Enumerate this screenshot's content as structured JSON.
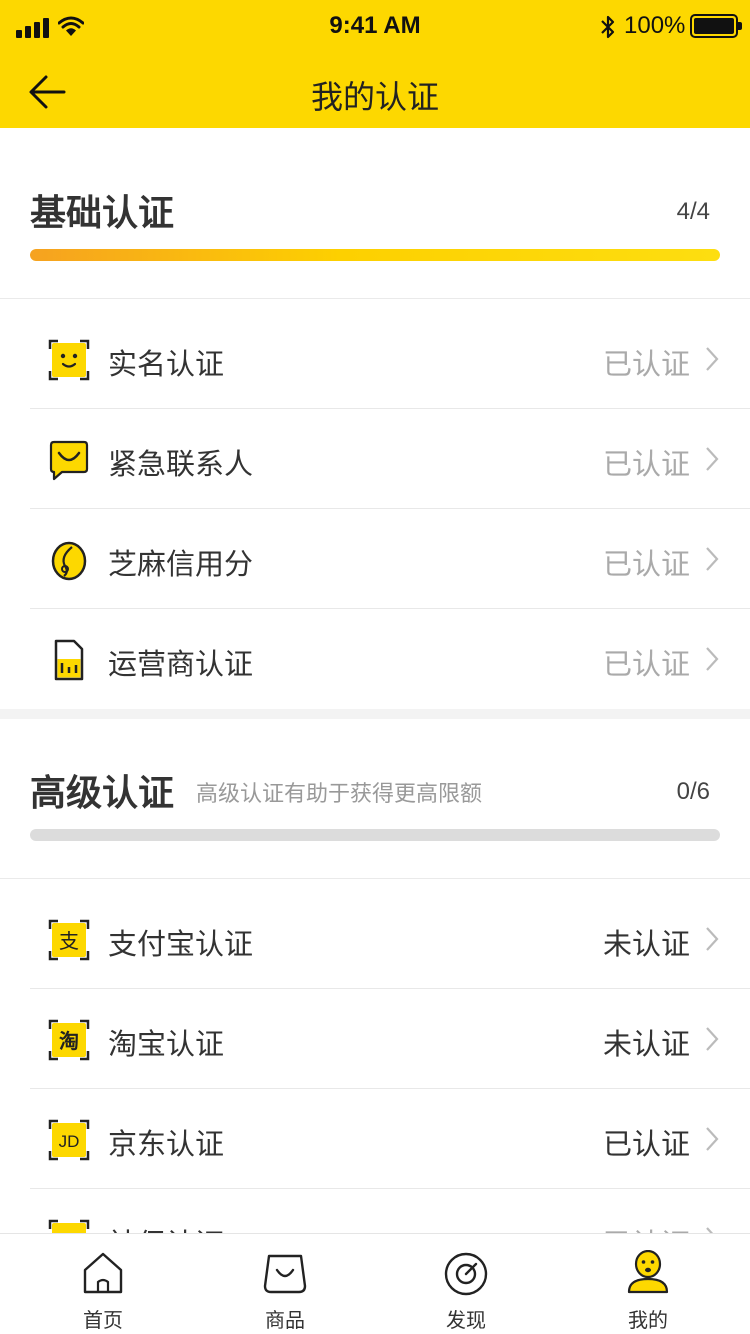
{
  "status_bar": {
    "time": "9:41 AM",
    "battery": "100%",
    "icons": [
      "signal-icon",
      "wifi-icon",
      "bluetooth-icon",
      "battery-icon"
    ]
  },
  "nav": {
    "title": "我的认证",
    "back_icon": "back-arrow-icon"
  },
  "colors": {
    "accent": "#FDD800",
    "progress_start": "#F6A220",
    "progress_end": "#FDDE10",
    "done_text": "#AAAAAA"
  },
  "basic": {
    "title": "基础认证",
    "count": "4/4",
    "progress": 1.0,
    "items": [
      {
        "label": "实名认证",
        "status": "已认证",
        "icon": "face-id-icon"
      },
      {
        "label": "紧急联系人",
        "status": "已认证",
        "icon": "chat-smile-icon"
      },
      {
        "label": "芝麻信用分",
        "status": "已认证",
        "icon": "sesame-icon"
      },
      {
        "label": "运营商认证",
        "status": "已认证",
        "icon": "sim-card-icon"
      }
    ]
  },
  "advanced": {
    "title": "高级认证",
    "subtitle": "高级认证有助于获得更高限额",
    "count": "0/6",
    "progress": 0.0,
    "items": [
      {
        "label": "支付宝认证",
        "status": "未认证",
        "icon": "alipay-icon",
        "icon_text": "支"
      },
      {
        "label": "淘宝认证",
        "status": "未认证",
        "icon": "taobao-icon",
        "icon_text": "淘"
      },
      {
        "label": "京东认证",
        "status": "已认证",
        "icon": "jd-icon",
        "icon_text": "JD"
      },
      {
        "label": "社保认证",
        "status": "已认证",
        "icon": "social-security-icon"
      }
    ]
  },
  "tabs": [
    {
      "label": "首页",
      "icon": "home-icon"
    },
    {
      "label": "商品",
      "icon": "shopping-bag-icon"
    },
    {
      "label": "发现",
      "icon": "compass-icon"
    },
    {
      "label": "我的",
      "icon": "profile-icon",
      "active": true
    }
  ]
}
